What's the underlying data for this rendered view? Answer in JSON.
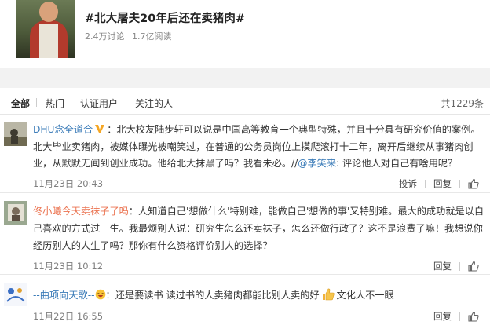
{
  "topic": {
    "title": "#北大屠夫20年后还在卖猪肉#",
    "discussions": "2.4万讨论",
    "reads": "1.7亿阅读"
  },
  "tabs": {
    "all": "全部",
    "hot": "热门",
    "verified": "认证用户",
    "following": "关注的人",
    "total": "共1229条"
  },
  "comments": [
    {
      "username": "DHU念全道合",
      "lines": [
        "：北大校友陆步轩可以说是中国高等教育一个典型特殊，并且十分具有研究价值的案例。",
        "北大毕业卖猪肉，被媒体曝光被嘲笑过，在普通的公务员岗位上摸爬滚打十二年，离开后继续从事猪肉创",
        "业，从默默无闻到创业成功。他给北大抹黑了吗？我看未必。//"
      ],
      "mention": "@李笑来",
      "mention_suffix": ": 评论他人对自己有啥用呢？",
      "time": "11月23日 20:43",
      "actions": [
        "投诉",
        "回复"
      ]
    },
    {
      "username": "佟小曦今天卖袜子了吗",
      "lines": [
        "：人知道自己'想做什么'特别难，能做自己'想做的事'又特别难。最大的成功就是以自",
        "己喜欢的方式过一生。我最烦别人说：研究生怎么还卖袜子，怎么还做行政了？这不是浪费了嘛！我想说你",
        "经历别人的人生了吗？那你有什么资格评价别人的选择？"
      ],
      "time": "11月23日 10:12",
      "actions": [
        "回复"
      ]
    },
    {
      "username": "--曲项向天歌--",
      "text": "：还是要读书 读过书的人卖猪肉都能比别人卖的好",
      "text_suffix": "文化人不一眼",
      "time": "11月22日 16:55",
      "actions": [
        "回复"
      ]
    }
  ]
}
